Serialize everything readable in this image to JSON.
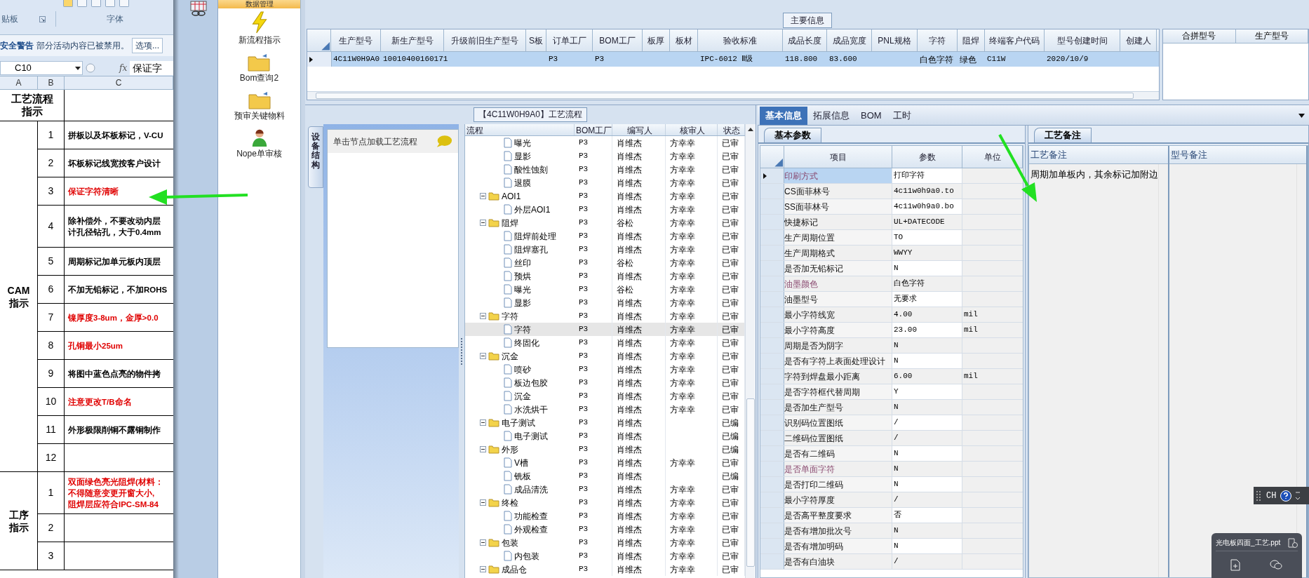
{
  "excel": {
    "ribbon_groups": [
      {
        "label": "贴板",
        "launcher": true
      },
      {
        "label": "字体",
        "launcher": false
      }
    ],
    "security_bar": {
      "title": "安全警告",
      "message": "部分活动内容已被禁用。",
      "button": "选项..."
    },
    "name_box": "C10",
    "fx": "fx",
    "formula": "保证字",
    "columns": [
      "A",
      "B",
      "C"
    ],
    "header_label": "工艺流程指示",
    "sections": [
      {
        "label": "CAM指示",
        "rows": [
          {
            "num": "1",
            "lines": [
              "拼板以及坏板标记，V-CU"
            ],
            "red": false
          },
          {
            "num": "2",
            "lines": [
              "坏板标记线宽按客户设计"
            ],
            "red": false
          },
          {
            "num": "3",
            "lines": [
              "保证字符清晰"
            ],
            "red": true
          },
          {
            "num": "4",
            "lines": [
              "除补偿外，不要改动内层",
              "计孔径钻孔，大于0.4mm"
            ],
            "red": false
          },
          {
            "num": "5",
            "lines": [
              "周期标记加单元板内顶层"
            ],
            "red": false
          },
          {
            "num": "6",
            "lines": [
              "不加无铅标记，不加ROHS"
            ],
            "red": false
          },
          {
            "num": "7",
            "lines": [
              "镍厚度3-8um，金厚>0.0"
            ],
            "red": true
          },
          {
            "num": "8",
            "lines": [
              "孔铜最小25um"
            ],
            "red": true
          },
          {
            "num": "9",
            "lines": [
              "将图中蓝色点亮的物件拷"
            ],
            "red": false
          },
          {
            "num": "10",
            "lines": [
              "注意更改T/B命名"
            ],
            "red": true
          },
          {
            "num": "11",
            "lines": [
              "外形极限削铜不露铜制作"
            ],
            "red": false
          },
          {
            "num": "12",
            "lines": []
          }
        ]
      },
      {
        "label": "工序指示",
        "rows": [
          {
            "num": "1",
            "lines": [
              "双面绿色亮光阻焊(材料：",
              "不得随意变更开窗大小,",
              "阻焊层应符合IPC-SM-84"
            ],
            "red": true
          },
          {
            "num": "2",
            "lines": []
          },
          {
            "num": "3",
            "lines": []
          }
        ]
      }
    ]
  },
  "nav": {
    "header": "数据管理",
    "items": [
      {
        "label": "新流程指示",
        "kind": "lightning"
      },
      {
        "label": "Bom查询2",
        "kind": "folder"
      },
      {
        "label": "预审关键物料",
        "kind": "folder"
      },
      {
        "label": "Nope单审核",
        "kind": "person"
      }
    ]
  },
  "main_info": {
    "title": "主要信息",
    "columns": [
      "生产型号",
      "新生产型号",
      "升级前旧生产型号",
      "S板",
      "订单工厂",
      "BOM工厂",
      "板厚",
      "板材",
      "验收标准",
      "成品长度",
      "成品宽度",
      "PNL规格",
      "字符",
      "阻焊",
      "终端客户代码",
      "型号创建时间",
      "创建人"
    ],
    "rows": [
      {
        "selected": true,
        "cells": [
          "4C11W0H9A0",
          "10010400160171",
          null,
          null,
          "P3",
          "P3",
          null,
          null,
          "IPC-6012 Ⅱ级",
          "118.800",
          "83.600",
          null,
          "白色字符",
          "绿色",
          "C11W",
          "2020/10/9",
          null
        ]
      }
    ],
    "side_columns": [
      "合拼型号",
      "生产型号"
    ]
  },
  "flow": {
    "title": "【4C11W0H9A0】工艺流程",
    "side_tab": "设备结构",
    "hint": "单击节点加载工艺流程",
    "columns": [
      "流程",
      "BOM工厂",
      "编写人",
      "核审人",
      "状态"
    ],
    "continued": [
      {
        "label": "曝光",
        "factory": "P3",
        "writer": "肖维杰",
        "reviewer": "方幸幸",
        "status": "已审",
        "selected": false
      },
      {
        "label": "显影",
        "factory": "P3",
        "writer": "肖维杰",
        "reviewer": "方幸幸",
        "status": "已审",
        "selected": false
      },
      {
        "label": "酸性蚀刻",
        "factory": "P3",
        "writer": "肖维杰",
        "reviewer": "方幸幸",
        "status": "已审",
        "selected": false
      },
      {
        "label": "退膜",
        "factory": "P3",
        "writer": "肖维杰",
        "reviewer": "方幸幸",
        "status": "已审",
        "selected": false
      }
    ],
    "nodes": [
      {
        "label": "AOI1",
        "factory": "P3",
        "writer": "肖维杰",
        "reviewer": "方幸幸",
        "status": "已审",
        "selected": false,
        "expanded": true,
        "children": [
          {
            "label": "外层AOI1",
            "factory": "P3",
            "writer": "肖维杰",
            "reviewer": "方幸幸",
            "status": "已审",
            "selected": false
          }
        ]
      },
      {
        "label": "阻焊",
        "factory": "P3",
        "writer": "谷松",
        "reviewer": "方幸幸",
        "status": "已审",
        "selected": false,
        "expanded": true,
        "children": [
          {
            "label": "阻焊前处理",
            "factory": "P3",
            "writer": "肖维杰",
            "reviewer": "方幸幸",
            "status": "已审",
            "selected": false
          },
          {
            "label": "阻焊塞孔",
            "factory": "P3",
            "writer": "肖维杰",
            "reviewer": "方幸幸",
            "status": "已审",
            "selected": false
          },
          {
            "label": "丝印",
            "factory": "P3",
            "writer": "谷松",
            "reviewer": "方幸幸",
            "status": "已审",
            "selected": false
          },
          {
            "label": "预烘",
            "factory": "P3",
            "writer": "肖维杰",
            "reviewer": "方幸幸",
            "status": "已审",
            "selected": false
          },
          {
            "label": "曝光",
            "factory": "P3",
            "writer": "谷松",
            "reviewer": "方幸幸",
            "status": "已审",
            "selected": false
          },
          {
            "label": "显影",
            "factory": "P3",
            "writer": "肖维杰",
            "reviewer": "方幸幸",
            "status": "已审",
            "selected": false
          }
        ]
      },
      {
        "label": "字符",
        "factory": "P3",
        "writer": "肖维杰",
        "reviewer": "方幸幸",
        "status": "已审",
        "selected": false,
        "expanded": true,
        "children": [
          {
            "label": "字符",
            "factory": "P3",
            "writer": "肖维杰",
            "reviewer": "方幸幸",
            "status": "已审",
            "selected": true
          },
          {
            "label": "终固化",
            "factory": "P3",
            "writer": "肖维杰",
            "reviewer": "方幸幸",
            "status": "已审",
            "selected": false
          }
        ]
      },
      {
        "label": "沉金",
        "factory": "P3",
        "writer": "肖维杰",
        "reviewer": "方幸幸",
        "status": "已审",
        "selected": false,
        "expanded": true,
        "children": [
          {
            "label": "喷砂",
            "factory": "P3",
            "writer": "肖维杰",
            "reviewer": "方幸幸",
            "status": "已审",
            "selected": false
          },
          {
            "label": "板边包胶",
            "factory": "P3",
            "writer": "肖维杰",
            "reviewer": "方幸幸",
            "status": "已审",
            "selected": false
          },
          {
            "label": "沉金",
            "factory": "P3",
            "writer": "肖维杰",
            "reviewer": "方幸幸",
            "status": "已审",
            "selected": false
          },
          {
            "label": "水洗烘干",
            "factory": "P3",
            "writer": "肖维杰",
            "reviewer": "方幸幸",
            "status": "已审",
            "selected": false
          }
        ]
      },
      {
        "label": "电子测试",
        "factory": "P3",
        "writer": "肖维杰",
        "status": "已编",
        "selected": false,
        "expanded": true,
        "children": [
          {
            "label": "电子测试",
            "factory": "P3",
            "writer": "肖维杰",
            "status": "已编",
            "selected": false
          }
        ]
      },
      {
        "label": "外形",
        "factory": "P3",
        "writer": "肖维杰",
        "status": "已编",
        "selected": false,
        "expanded": true,
        "children": [
          {
            "label": "V槽",
            "factory": "P3",
            "writer": "肖维杰",
            "reviewer": "方幸幸",
            "status": "已审",
            "selected": false
          },
          {
            "label": "铣板",
            "factory": "P3",
            "writer": "肖维杰",
            "status": "已编",
            "selected": false
          },
          {
            "label": "成品清洗",
            "factory": "P3",
            "writer": "肖维杰",
            "reviewer": "方幸幸",
            "status": "已审",
            "selected": false
          }
        ]
      },
      {
        "label": "终检",
        "factory": "P3",
        "writer": "肖维杰",
        "reviewer": "方幸幸",
        "status": "已审",
        "selected": false,
        "expanded": true,
        "children": [
          {
            "label": "功能检查",
            "factory": "P3",
            "writer": "肖维杰",
            "reviewer": "方幸幸",
            "status": "已审",
            "selected": false
          },
          {
            "label": "外观检查",
            "factory": "P3",
            "writer": "肖维杰",
            "reviewer": "方幸幸",
            "status": "已审",
            "selected": false
          }
        ]
      },
      {
        "label": "包装",
        "factory": "P3",
        "writer": "肖维杰",
        "reviewer": "方幸幸",
        "status": "已审",
        "selected": false,
        "expanded": true,
        "children": [
          {
            "label": "内包装",
            "factory": "P3",
            "writer": "肖维杰",
            "reviewer": "方幸幸",
            "status": "已审",
            "selected": false
          }
        ]
      },
      {
        "label": "成品仓",
        "factory": "P3",
        "writer": "肖维杰",
        "reviewer": "方幸幸",
        "status": "已审",
        "selected": false,
        "expanded": true
      }
    ]
  },
  "info": {
    "tabs": [
      {
        "label": "基本信息",
        "selected": true
      },
      {
        "label": "拓展信息",
        "selected": false
      },
      {
        "label": "BOM",
        "selected": false
      },
      {
        "label": "工时",
        "selected": false
      }
    ],
    "params": {
      "tab": "基本参数",
      "columns": [
        "项目",
        "参数",
        "单位"
      ],
      "rows": [
        {
          "item": "印刷方式",
          "value": "打印字符",
          "emphasized": true,
          "selected": true
        },
        {
          "item": "CS面菲林号",
          "value": "4c11w0h9a0.to",
          "emphasized": false,
          "selected": false
        },
        {
          "item": "SS面菲林号",
          "value": "4c11w0h9a0.bo",
          "emphasized": false,
          "selected": false
        },
        {
          "item": "快捷标记",
          "value": "UL+DATECODE",
          "emphasized": false,
          "selected": false
        },
        {
          "item": "生产周期位置",
          "value": "TO",
          "emphasized": false,
          "selected": false
        },
        {
          "item": "生产周期格式",
          "value": "WWYY",
          "emphasized": false,
          "selected": false
        },
        {
          "item": "是否加无铅标记",
          "value": "N",
          "emphasized": false,
          "selected": false
        },
        {
          "item": "油墨颜色",
          "value": "白色字符",
          "emphasized": true,
          "selected": false
        },
        {
          "item": "油墨型号",
          "value": "无要求",
          "emphasized": false,
          "selected": false
        },
        {
          "item": "最小字符线宽",
          "value": "4.00",
          "unit": "mil",
          "emphasized": false,
          "selected": false
        },
        {
          "item": "最小字符高度",
          "value": "23.00",
          "unit": "mil",
          "emphasized": false,
          "selected": false
        },
        {
          "item": "周期是否为阴字",
          "value": "N",
          "emphasized": false,
          "selected": false
        },
        {
          "item": "是否有字符上表面处理设计",
          "value": "N",
          "emphasized": false,
          "selected": false
        },
        {
          "item": "字符到焊盘最小距离",
          "value": "6.00",
          "unit": "mil",
          "emphasized": false,
          "selected": false
        },
        {
          "item": "是否字符框代替周期",
          "value": "Y",
          "emphasized": false,
          "selected": false
        },
        {
          "item": "是否加生产型号",
          "value": "N",
          "emphasized": false,
          "selected": false
        },
        {
          "item": "识别码位置图纸",
          "value": "/",
          "emphasized": false,
          "selected": false
        },
        {
          "item": "二维码位置图纸",
          "value": "/",
          "emphasized": false,
          "selected": false
        },
        {
          "item": "是否有二维码",
          "value": "N",
          "emphasized": false,
          "selected": false
        },
        {
          "item": "是否单面字符",
          "value": "N",
          "emphasized": true,
          "selected": false
        },
        {
          "item": "是否打印二维码",
          "value": "N",
          "emphasized": false,
          "selected": false
        },
        {
          "item": "最小字符厚度",
          "value": "/",
          "emphasized": false,
          "selected": false
        },
        {
          "item": "是否高平整度要求",
          "value": "否",
          "emphasized": false,
          "selected": false
        },
        {
          "item": "是否有增加批次号",
          "value": "N",
          "emphasized": false,
          "selected": false
        },
        {
          "item": "是否有增加明码",
          "value": "N",
          "emphasized": false,
          "selected": false
        },
        {
          "item": "是否有白油块",
          "value": "/",
          "emphasized": false,
          "selected": false
        }
      ]
    },
    "remarks": {
      "tab": "工艺备注",
      "columns": [
        "工艺备注",
        "型号备注"
      ],
      "process_note": "周期加单板内，其余标记加附边"
    }
  },
  "language_bar": {
    "label": "CH"
  },
  "notification": {
    "file": "光电板四面_工艺.ppt"
  }
}
